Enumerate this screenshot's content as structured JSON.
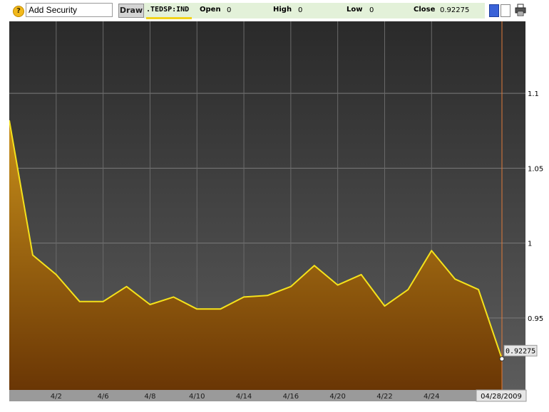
{
  "toolbar": {
    "help_icon": "?",
    "add_security_placeholder": "Add Security",
    "draw_label": "Draw",
    "ticker": ".TEDSP:IND",
    "open_label": "Open",
    "open_value": "0",
    "high_label": "High",
    "high_value": "0",
    "low_label": "Low",
    "low_value": "0",
    "close_label": "Close",
    "close_value": "0.92275",
    "icons": [
      "help-icon",
      "color-swatch-blue",
      "color-swatch-white",
      "printer-icon"
    ]
  },
  "colors": {
    "line": "#f5e21b",
    "fill_top": "#c8901a",
    "fill_bottom": "#6a3605",
    "bg_top": "#2a2a2a",
    "bg_bottom": "#5c5c5c",
    "cursor": "#e07a3a",
    "quote_bar": "#e3f1d9"
  },
  "chart_data": {
    "type": "area",
    "x": [
      "3/31",
      "4/1",
      "4/2",
      "4/3",
      "4/6",
      "4/7",
      "4/8",
      "4/9",
      "4/10",
      "4/13",
      "4/14",
      "4/15",
      "4/16",
      "4/17",
      "4/20",
      "4/21",
      "4/22",
      "4/23",
      "4/24",
      "4/27",
      "4/28"
    ],
    "values": [
      1.082,
      0.992,
      0.979,
      0.961,
      0.961,
      0.971,
      0.959,
      0.964,
      0.956,
      0.956,
      0.964,
      0.965,
      0.971,
      0.985,
      0.972,
      0.979,
      0.958,
      0.969,
      0.995,
      0.976,
      0.969,
      0.92275
    ],
    "x_ticks": [
      "4/2",
      "4/6",
      "4/8",
      "4/10",
      "4/14",
      "4/16",
      "4/20",
      "4/22",
      "4/24"
    ],
    "y_ticks": [
      "0.95",
      "1",
      "1.05",
      "1.1"
    ],
    "ylim": [
      0.902,
      1.148
    ],
    "last_value_label": "0.92275",
    "cursor_date": "04/28/2009",
    "grid": true,
    "y_axis_side": "right"
  }
}
